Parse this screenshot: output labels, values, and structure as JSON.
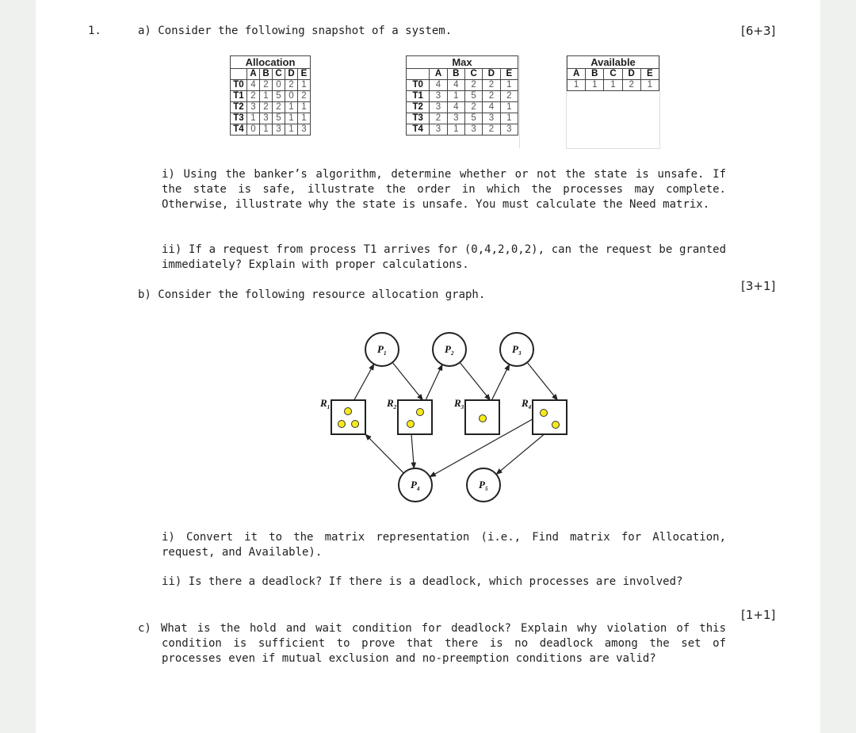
{
  "question": {
    "number": "1.",
    "part_a": {
      "intro": "a) Consider the following snapshot of a system.",
      "marks": "[6+3]",
      "allocation": {
        "title": "Allocation",
        "columns": [
          "A",
          "B",
          "C",
          "D",
          "E"
        ],
        "rows": [
          {
            "label": "T0",
            "values": [
              "4",
              "2",
              "0",
              "2",
              "1"
            ]
          },
          {
            "label": "T1",
            "values": [
              "2",
              "1",
              "5",
              "0",
              "2"
            ]
          },
          {
            "label": "T2",
            "values": [
              "3",
              "2",
              "2",
              "1",
              "1"
            ]
          },
          {
            "label": "T3",
            "values": [
              "1",
              "3",
              "5",
              "1",
              "1"
            ]
          },
          {
            "label": "T4",
            "values": [
              "0",
              "1",
              "3",
              "1",
              "3"
            ]
          }
        ]
      },
      "max": {
        "title": "Max",
        "columns": [
          "A",
          "B",
          "C",
          "D",
          "E"
        ],
        "rows": [
          {
            "label": "T0",
            "values": [
              "4",
              "4",
              "2",
              "2",
              "1"
            ]
          },
          {
            "label": "T1",
            "values": [
              "3",
              "1",
              "5",
              "2",
              "2"
            ]
          },
          {
            "label": "T2",
            "values": [
              "3",
              "4",
              "2",
              "4",
              "1"
            ]
          },
          {
            "label": "T3",
            "values": [
              "2",
              "3",
              "5",
              "3",
              "1"
            ]
          },
          {
            "label": "T4",
            "values": [
              "3",
              "1",
              "3",
              "2",
              "3"
            ]
          }
        ]
      },
      "available": {
        "title": "Available",
        "columns": [
          "A",
          "B",
          "C",
          "D",
          "E"
        ],
        "values": [
          "1",
          "1",
          "1",
          "2",
          "1"
        ]
      },
      "sub_i": "i) Using the banker’s algorithm, determine whether or not the state is unsafe. If the state is safe, illustrate the order in which the processes may complete. Otherwise, illustrate why the state is unsafe. You must calculate the Need matrix.",
      "sub_ii": "ii) If a request from process T1 arrives for (0,4,2,0,2), can the request be granted immediately? Explain with proper calculations."
    },
    "part_b": {
      "intro": "b) Consider the following resource allocation graph.",
      "marks": "[3+1]",
      "graph": {
        "processes": [
          {
            "id": "P1",
            "label": "P",
            "sub": "1"
          },
          {
            "id": "P2",
            "label": "P",
            "sub": "2"
          },
          {
            "id": "P3",
            "label": "P",
            "sub": "3"
          },
          {
            "id": "P4",
            "label": "P",
            "sub": "4"
          },
          {
            "id": "P5",
            "label": "P",
            "sub": "5"
          }
        ],
        "resources": [
          {
            "id": "R1",
            "label": "R",
            "sub": "1",
            "instances": 3
          },
          {
            "id": "R2",
            "label": "R",
            "sub": "2",
            "instances": 2
          },
          {
            "id": "R3",
            "label": "R",
            "sub": "3",
            "instances": 1
          },
          {
            "id": "R4",
            "label": "R",
            "sub": "4",
            "instances": 2
          }
        ],
        "edges": [
          {
            "from": "R1",
            "to": "P1",
            "type": "assignment"
          },
          {
            "from": "P1",
            "to": "R2",
            "type": "request"
          },
          {
            "from": "R2",
            "to": "P2",
            "type": "assignment"
          },
          {
            "from": "P2",
            "to": "R3",
            "type": "request"
          },
          {
            "from": "R3",
            "to": "P3",
            "type": "assignment"
          },
          {
            "from": "P3",
            "to": "R4",
            "type": "request"
          },
          {
            "from": "R2",
            "to": "P4",
            "type": "assignment"
          },
          {
            "from": "P4",
            "to": "R1",
            "type": "request"
          },
          {
            "from": "R4",
            "to": "P4",
            "type": "assignment"
          },
          {
            "from": "R4",
            "to": "P5",
            "type": "assignment"
          }
        ],
        "instance_color": "#f5ea1a"
      },
      "sub_i": "i) Convert it to the matrix representation (i.e., Find matrix for Allocation, request, and Available).",
      "sub_ii": "ii) Is there a deadlock? If there is a deadlock, which processes are involved?"
    },
    "part_c": {
      "text": "c) What is the hold and wait condition for deadlock? Explain why violation of this condition is sufficient to prove that there is no deadlock among the set of processes even if mutual exclusion and no-preemption conditions are valid?",
      "marks": "[1+1]"
    }
  }
}
